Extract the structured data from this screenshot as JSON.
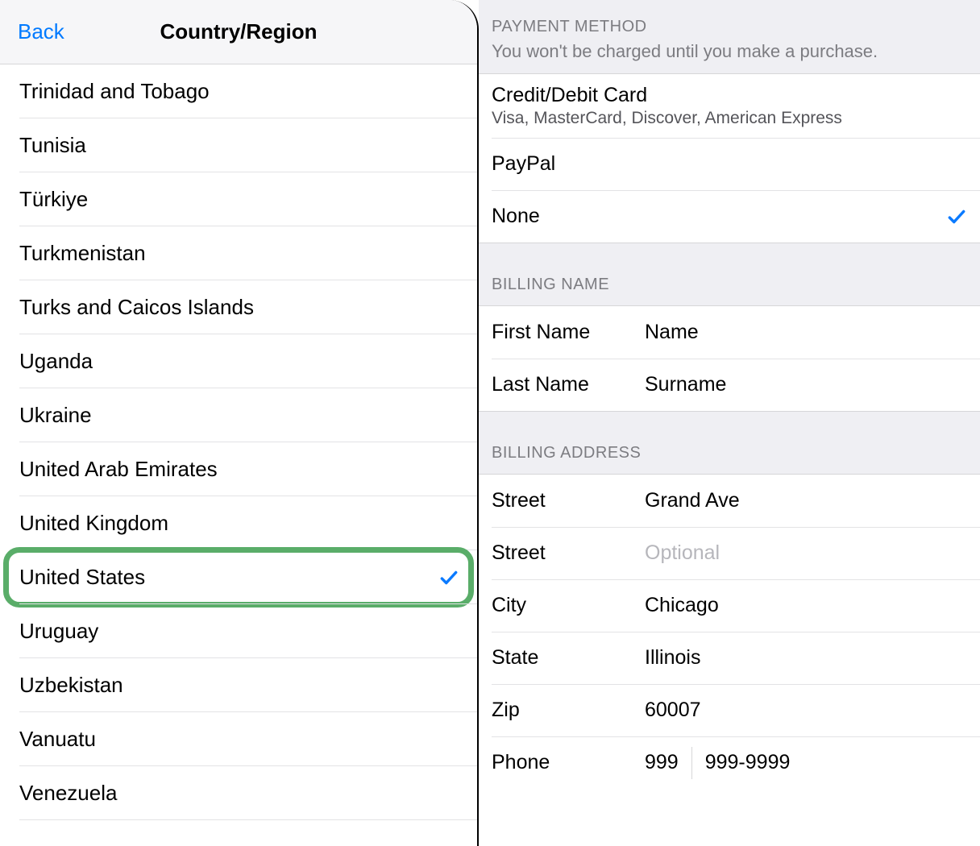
{
  "left": {
    "back_label": "Back",
    "title": "Country/Region",
    "countries": [
      {
        "name": "Trinidad and Tobago",
        "selected": false,
        "highlighted": false
      },
      {
        "name": "Tunisia",
        "selected": false,
        "highlighted": false
      },
      {
        "name": "Türkiye",
        "selected": false,
        "highlighted": false
      },
      {
        "name": "Turkmenistan",
        "selected": false,
        "highlighted": false
      },
      {
        "name": "Turks and Caicos Islands",
        "selected": false,
        "highlighted": false
      },
      {
        "name": "Uganda",
        "selected": false,
        "highlighted": false
      },
      {
        "name": "Ukraine",
        "selected": false,
        "highlighted": false
      },
      {
        "name": "United Arab Emirates",
        "selected": false,
        "highlighted": false
      },
      {
        "name": "United Kingdom",
        "selected": false,
        "highlighted": false
      },
      {
        "name": "United States",
        "selected": true,
        "highlighted": true
      },
      {
        "name": "Uruguay",
        "selected": false,
        "highlighted": false
      },
      {
        "name": "Uzbekistan",
        "selected": false,
        "highlighted": false
      },
      {
        "name": "Vanuatu",
        "selected": false,
        "highlighted": false
      },
      {
        "name": "Venezuela",
        "selected": false,
        "highlighted": false
      }
    ]
  },
  "right": {
    "payment": {
      "section_title": "PAYMENT METHOD",
      "section_sub": "You won't be charged until you make a purchase.",
      "options": [
        {
          "title": "Credit/Debit Card",
          "sub": "Visa, MasterCard, Discover, American Express",
          "selected": false
        },
        {
          "title": "PayPal",
          "sub": "",
          "selected": false
        },
        {
          "title": "None",
          "sub": "",
          "selected": true
        }
      ]
    },
    "billing_name": {
      "section_title": "BILLING NAME",
      "fields": [
        {
          "label": "First Name",
          "value": "Name",
          "placeholder": ""
        },
        {
          "label": "Last Name",
          "value": "Surname",
          "placeholder": ""
        }
      ]
    },
    "billing_address": {
      "section_title": "BILLING ADDRESS",
      "fields": [
        {
          "label": "Street",
          "value": "Grand Ave",
          "placeholder": ""
        },
        {
          "label": "Street",
          "value": "",
          "placeholder": "Optional"
        },
        {
          "label": "City",
          "value": "Chicago",
          "placeholder": ""
        },
        {
          "label": "State",
          "value": "Illinois",
          "placeholder": ""
        },
        {
          "label": "Zip",
          "value": "60007",
          "placeholder": ""
        }
      ],
      "phone": {
        "label": "Phone",
        "area": "999",
        "number": "999-9999"
      }
    }
  },
  "colors": {
    "accent": "#007aff",
    "highlight": "#5aad69"
  }
}
